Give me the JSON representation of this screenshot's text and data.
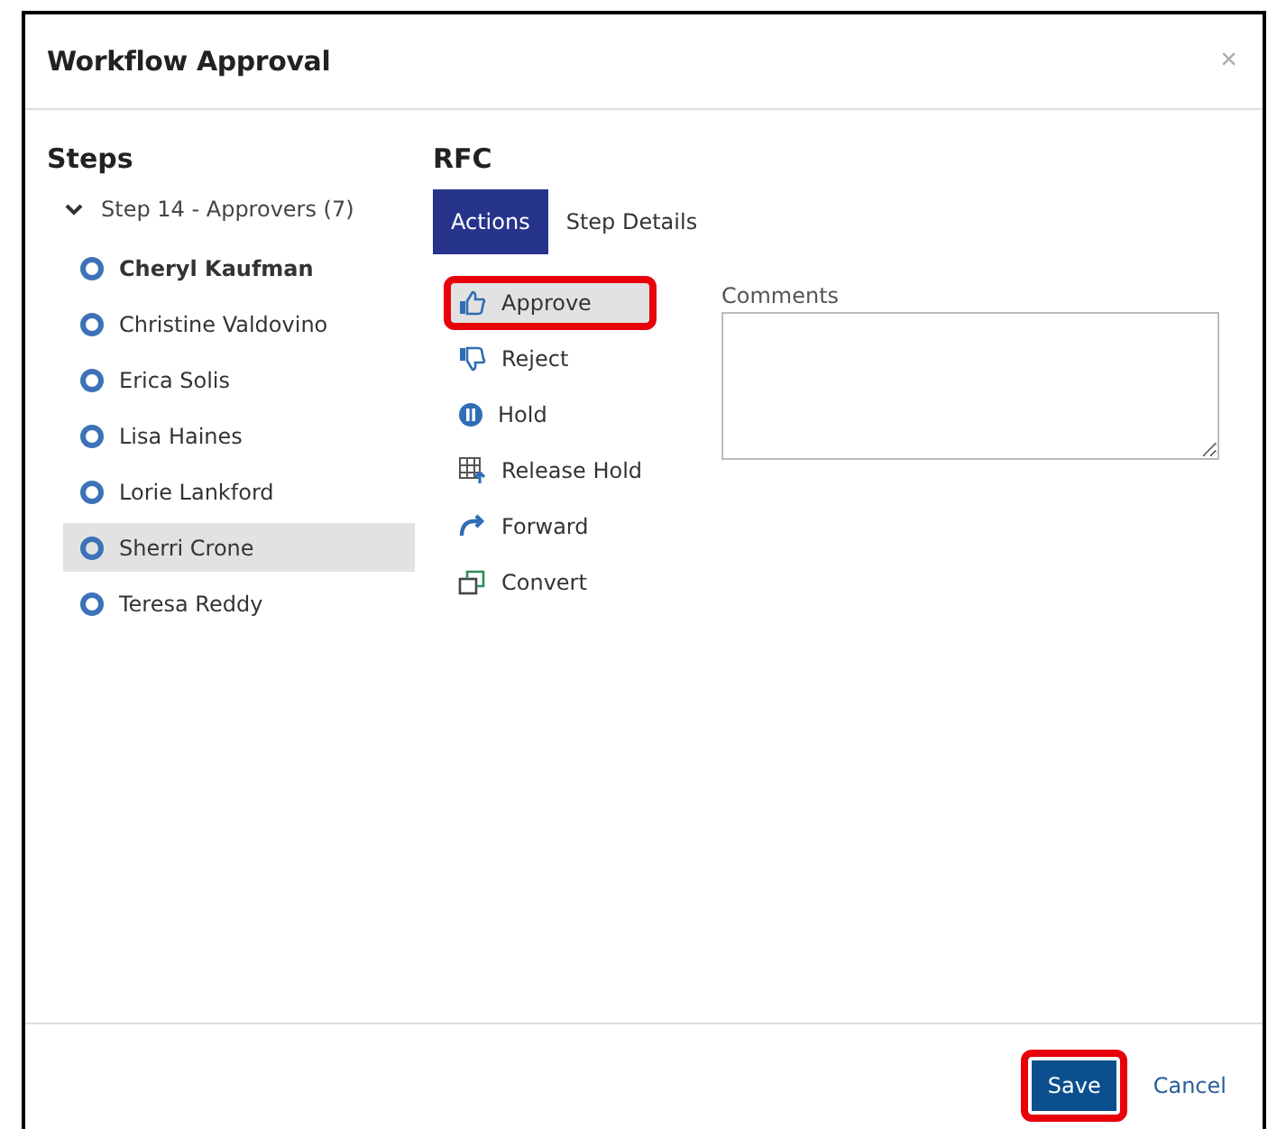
{
  "dialog": {
    "title": "Workflow Approval",
    "close": "×"
  },
  "steps": {
    "heading": "Steps",
    "group": {
      "label": "Step 14 - Approvers (7)",
      "expanded": true
    },
    "approvers": [
      {
        "name": "Cheryl Kaufman",
        "current": true,
        "selected": false
      },
      {
        "name": "Christine Valdovino",
        "current": false,
        "selected": false
      },
      {
        "name": "Erica Solis",
        "current": false,
        "selected": false
      },
      {
        "name": "Lisa Haines",
        "current": false,
        "selected": false
      },
      {
        "name": "Lorie Lankford",
        "current": false,
        "selected": false
      },
      {
        "name": "Sherri Crone",
        "current": false,
        "selected": true
      },
      {
        "name": "Teresa Reddy",
        "current": false,
        "selected": false
      }
    ]
  },
  "detail": {
    "heading": "RFC",
    "tabs": [
      {
        "label": "Actions",
        "selected": true
      },
      {
        "label": "Step Details",
        "selected": false
      }
    ],
    "actions": [
      {
        "kind": "approve",
        "label": "Approve",
        "selected": true,
        "highlighted": true
      },
      {
        "kind": "reject",
        "label": "Reject",
        "selected": false,
        "highlighted": false
      },
      {
        "kind": "hold",
        "label": "Hold",
        "selected": false,
        "highlighted": false
      },
      {
        "kind": "release",
        "label": "Release Hold",
        "selected": false,
        "highlighted": false
      },
      {
        "kind": "forward",
        "label": "Forward",
        "selected": false,
        "highlighted": false
      },
      {
        "kind": "convert",
        "label": "Convert",
        "selected": false,
        "highlighted": false
      }
    ],
    "comments": {
      "label": "Comments"
    }
  },
  "footer": {
    "buttons": [
      {
        "kind": "primary",
        "label": "Save",
        "highlighted": true
      },
      {
        "kind": "link",
        "label": "Cancel",
        "highlighted": false
      }
    ]
  }
}
